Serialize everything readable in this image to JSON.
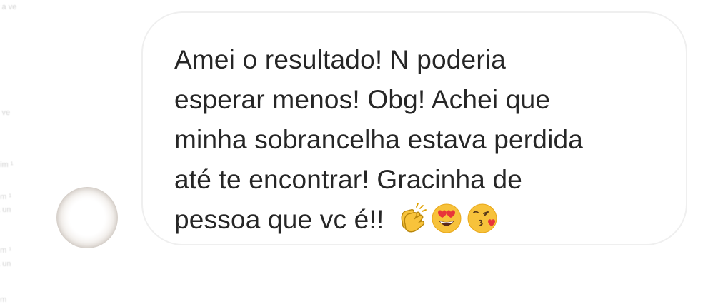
{
  "message": {
    "lines": [
      "Amei o resultado! N poderia",
      "esperar menos! Obg! Achei que",
      "minha sobrancelha estava perdida",
      "até te encontrar! Gracinha de",
      "pessoa que vc é!!"
    ],
    "emojis": [
      "clapping-hands-emoji",
      "heart-eyes-emoji",
      "kissing-heart-emoji"
    ]
  },
  "colors": {
    "text": "#262626",
    "bubble_border": "#efefef",
    "background": "#ffffff"
  }
}
